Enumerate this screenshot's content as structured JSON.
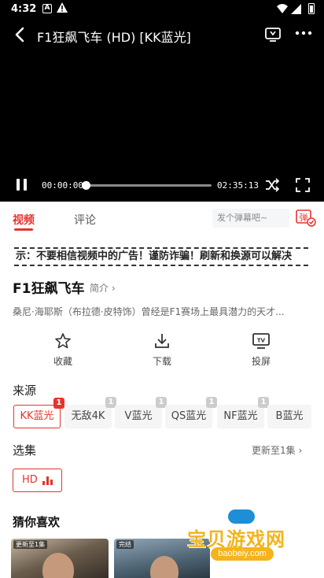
{
  "status_bar": {
    "time": "4:32",
    "a_icon_label": "A"
  },
  "player": {
    "title": "F1狂飙飞车 (HD) [KK蓝光]",
    "current_time": "00:00:00",
    "total_time": "02:35:13",
    "progress_fraction": 0.0
  },
  "tabs": {
    "video": "视频",
    "comment": "评论"
  },
  "danmu": {
    "placeholder": "发个弹幕吧~",
    "button_label": "弹"
  },
  "notice": "示：不要相信视频中的广告！谨防诈骗！刷新和换源可以解决",
  "show": {
    "title": "F1狂飙飞车",
    "intro_label": "简介",
    "description": "桑尼·海耶斯（布拉德·皮特饰）曾经是F1赛场上最具潜力的天才..."
  },
  "actions": [
    {
      "label": "收藏",
      "icon": "star-icon"
    },
    {
      "label": "下载",
      "icon": "download-icon"
    },
    {
      "label": "投屏",
      "icon": "tv-cast-icon"
    }
  ],
  "sources": {
    "label": "来源",
    "items": [
      {
        "label": "KK蓝光",
        "badge": "1",
        "active": true
      },
      {
        "label": "无敌4K",
        "badge": "1",
        "active": false
      },
      {
        "label": "V蓝光",
        "badge": "1",
        "active": false
      },
      {
        "label": "QS蓝光",
        "badge": "1",
        "active": false
      },
      {
        "label": "NF蓝光",
        "badge": "1",
        "active": false
      },
      {
        "label": "B蓝光",
        "badge": "",
        "active": false
      }
    ]
  },
  "episodes": {
    "label": "选集",
    "update_text": "更新至1集",
    "items": [
      {
        "label": "HD"
      }
    ]
  },
  "recommend": {
    "label": "猜你喜欢",
    "posters": [
      {
        "tag": "更新至1集"
      },
      {
        "tag": "完结"
      }
    ]
  },
  "watermark": {
    "title": "宝贝游戏网",
    "url": "baobeiy.com"
  },
  "colors": {
    "accent": "#e5342c",
    "player_bg": "#000000",
    "watermark": "#f3b41c"
  }
}
